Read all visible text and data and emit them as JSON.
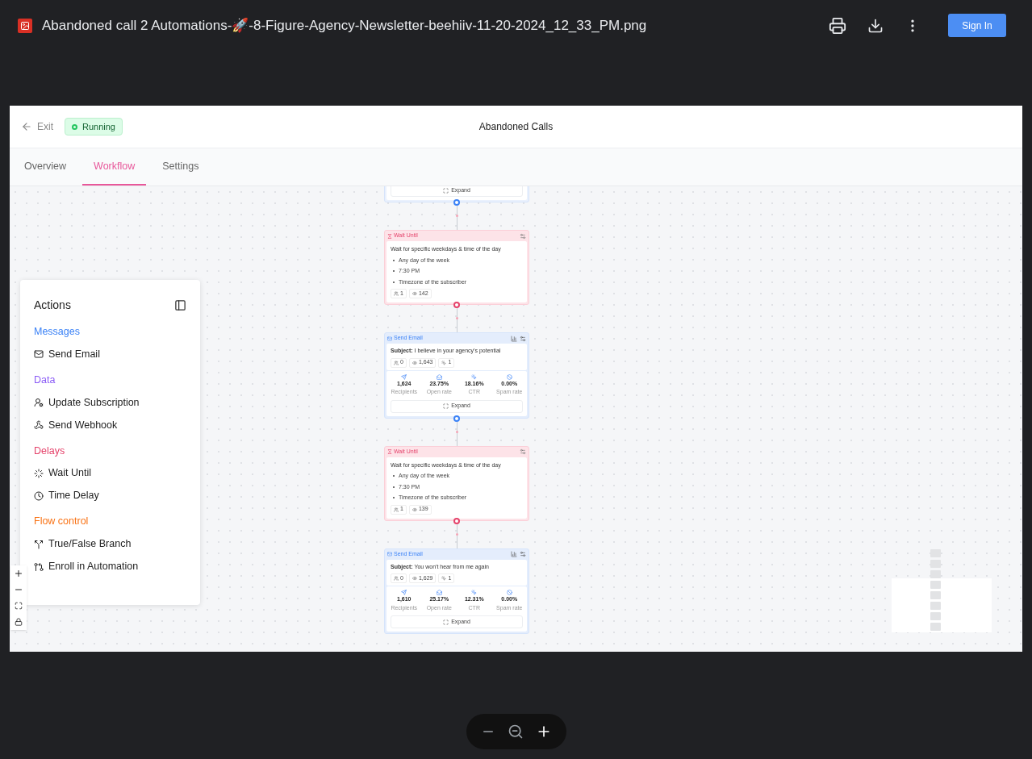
{
  "viewer": {
    "file_name": "Abandoned call 2 Automations-🚀-8-Figure-Agency-Newsletter-beehiiv-11-20-2024_12_33_PM.png",
    "sign_in": "Sign In"
  },
  "app": {
    "exit": "Exit",
    "status": "Running",
    "title": "Abandoned Calls",
    "tabs": [
      {
        "label": "Overview",
        "selected": false
      },
      {
        "label": "Workflow",
        "selected": true
      },
      {
        "label": "Settings",
        "selected": false
      }
    ]
  },
  "actions": {
    "title": "Actions",
    "groups": [
      {
        "title": "Messages",
        "color": "#3b82f6",
        "items": [
          {
            "label": "Send Email"
          }
        ]
      },
      {
        "title": "Data",
        "color": "#8b5cf6",
        "items": [
          {
            "label": "Update Subscription"
          },
          {
            "label": "Send Webhook"
          }
        ]
      },
      {
        "title": "Delays",
        "color": "#e5436b",
        "items": [
          {
            "label": "Wait Until"
          },
          {
            "label": "Time Delay"
          }
        ]
      },
      {
        "title": "Flow control",
        "color": "#f97316",
        "items": [
          {
            "label": "True/False Branch"
          },
          {
            "label": "Enroll in Automation"
          }
        ]
      }
    ]
  },
  "nodes": [
    {
      "kind": "partial",
      "expand": "Expand"
    },
    {
      "kind": "wait",
      "title": "Wait Until",
      "description": "Wait for specific weekdays & time of the day",
      "bullets": [
        "Any day of the week",
        "7:30 PM",
        "Timezone of the subscriber"
      ],
      "stats": [
        "1",
        "142"
      ]
    },
    {
      "kind": "email",
      "title": "Send Email",
      "subject": "**Subject:** I believe in your agency's potential",
      "stats": [
        "0",
        "1,643",
        "1"
      ],
      "metrics": [
        {
          "value": "1,624",
          "label": "Recipients"
        },
        {
          "value": "23.75%",
          "label": "Open rate"
        },
        {
          "value": "18.16%",
          "label": "CTR"
        },
        {
          "value": "0.00%",
          "label": "Spam rate"
        }
      ],
      "expand": "Expand"
    },
    {
      "kind": "wait",
      "title": "Wait Until",
      "description": "Wait for specific weekdays & time of the day",
      "bullets": [
        "Any day of the week",
        "7:30 PM",
        "Timezone of the subscriber"
      ],
      "stats": [
        "1",
        "139"
      ]
    },
    {
      "kind": "email",
      "title": "Send Email",
      "subject": "**Subject:** You won't hear from me again",
      "stats": [
        "0",
        "1,629",
        "1"
      ],
      "metrics": [
        {
          "value": "1,610",
          "label": "Recipients"
        },
        {
          "value": "25.17%",
          "label": "Open rate"
        },
        {
          "value": "12.31%",
          "label": "CTR"
        },
        {
          "value": "0.00%",
          "label": "Spam rate"
        }
      ],
      "expand": "Expand"
    }
  ]
}
